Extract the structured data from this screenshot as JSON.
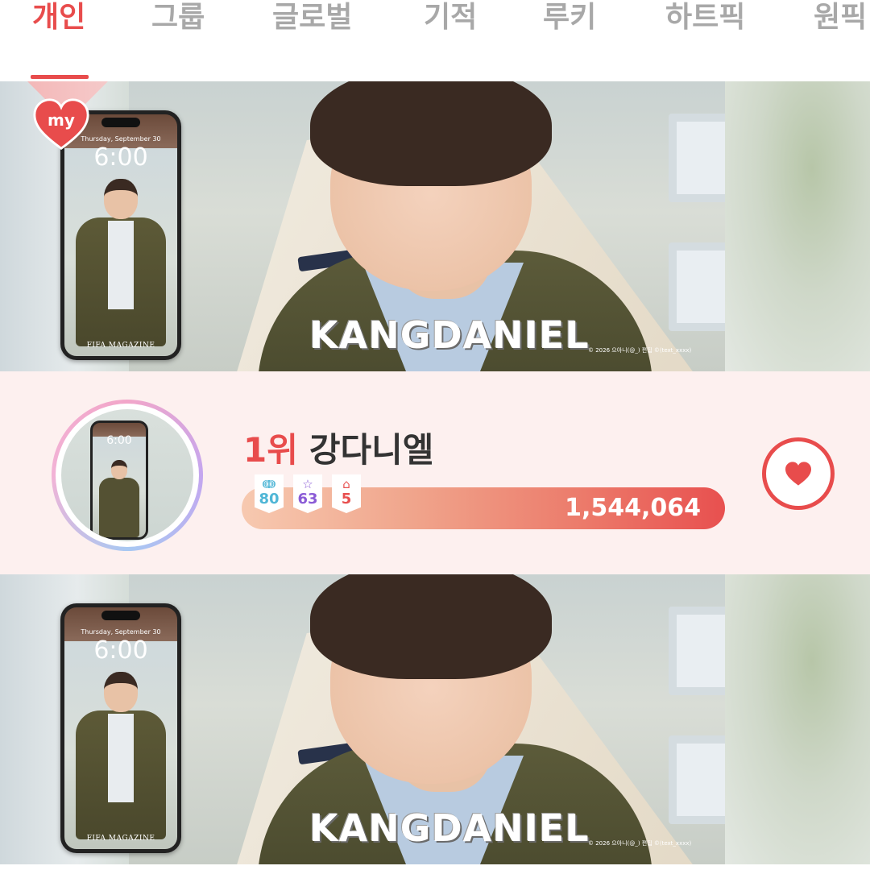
{
  "tabs": [
    {
      "label": "개인",
      "active": true
    },
    {
      "label": "그룹",
      "active": false
    },
    {
      "label": "글로벌",
      "active": false
    },
    {
      "label": "기적",
      "active": false
    },
    {
      "label": "루키",
      "active": false
    },
    {
      "label": "하트픽",
      "active": false
    },
    {
      "label": "원픽",
      "active": false
    }
  ],
  "banner": {
    "name_art": "KANGDANIEL",
    "copyright": "© 2026 으아니(@_) 편집 ©(text_xxxx)",
    "phone": {
      "date": "Thursday, September 30",
      "time": "6:00",
      "magazine": "FIFA MAGAZINE"
    },
    "badge": {
      "text": "my",
      "icon": "heart-icon",
      "color": "#e84c4c"
    }
  },
  "ranking": {
    "rank": "1위",
    "name": "강다니엘",
    "avatar_time": "6:00",
    "chips": [
      {
        "icon": "wings-icon",
        "value": "80",
        "color": "#4fb6d6"
      },
      {
        "icon": "star-icon",
        "value": "63",
        "color": "#8a5bd6"
      },
      {
        "icon": "cake-icon",
        "value": "5",
        "color": "#e8504f"
      }
    ],
    "total_votes": "1,544,064",
    "vote_button_icon": "heart-icon"
  },
  "colors": {
    "accent": "#e84c4c",
    "card_bg": "#fdf0ef",
    "tab_inactive": "#a8a8a8"
  }
}
